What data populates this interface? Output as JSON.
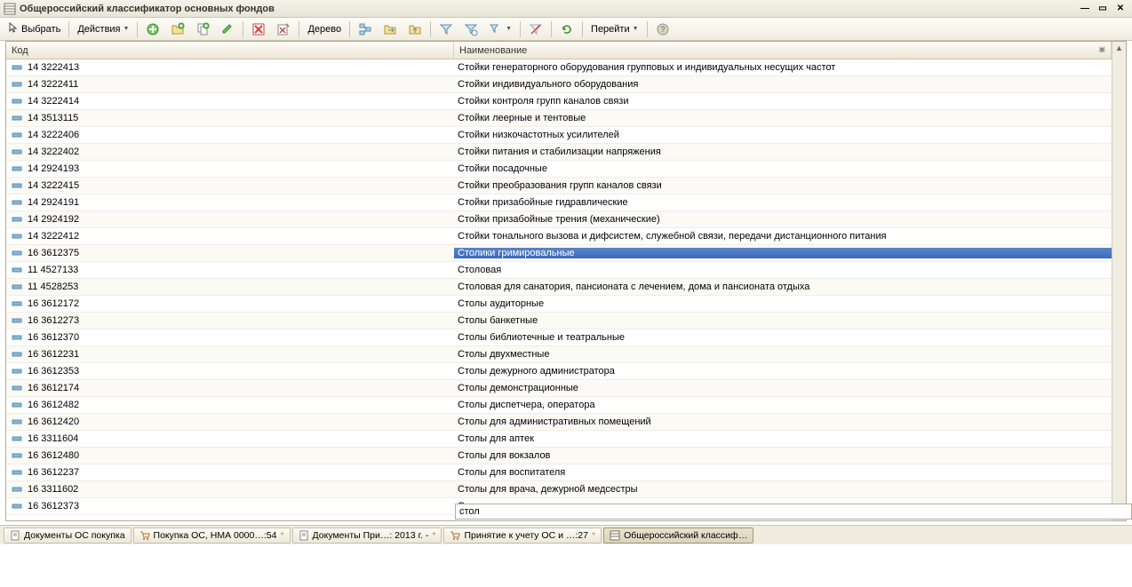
{
  "window": {
    "title": "Общероссийский классификатор основных фондов"
  },
  "toolbar": {
    "select": "Выбрать",
    "actions": "Действия",
    "tree": "Дерево",
    "goto": "Перейти"
  },
  "columns": {
    "code": "Код",
    "name": "Наименование"
  },
  "rows": [
    {
      "code": "14 3222413",
      "name": "Стойки генераторного оборудования групповых и индивидуальных несущих частот"
    },
    {
      "code": "14 3222411",
      "name": "Стойки индивидуального оборудования"
    },
    {
      "code": "14 3222414",
      "name": "Стойки контроля групп каналов связи"
    },
    {
      "code": "14 3513115",
      "name": "Стойки леерные и тентовые"
    },
    {
      "code": "14 3222406",
      "name": "Стойки низкочастотных усилителей"
    },
    {
      "code": "14 3222402",
      "name": "Стойки питания и стабилизации напряжения"
    },
    {
      "code": "14 2924193",
      "name": "Стойки посадочные"
    },
    {
      "code": "14 3222415",
      "name": "Стойки преобразования групп каналов связи"
    },
    {
      "code": "14 2924191",
      "name": "Стойки призабойные гидравлические"
    },
    {
      "code": "14 2924192",
      "name": "Стойки призабойные трения (механические)"
    },
    {
      "code": "14 3222412",
      "name": "Стойки тонального вызова и дифсистем, служебной связи, передачи дистанционного питания"
    },
    {
      "code": "16 3612375",
      "name": "Столики гримировальные",
      "selected": true
    },
    {
      "code": "11 4527133",
      "name": "Столовая"
    },
    {
      "code": "11 4528253",
      "name": "Столовая для санатория, пансионата с лечением, дома и пансионата отдыха"
    },
    {
      "code": "16 3612172",
      "name": "Столы аудиторные"
    },
    {
      "code": "16 3612273",
      "name": "Столы банкетные"
    },
    {
      "code": "16 3612370",
      "name": "Столы библиотечные и театральные"
    },
    {
      "code": "16 3612231",
      "name": "Столы двухместные"
    },
    {
      "code": "16 3612353",
      "name": "Столы дежурного администратора"
    },
    {
      "code": "16 3612174",
      "name": "Столы демонстрационные"
    },
    {
      "code": "16 3612482",
      "name": "Столы диспетчера, оператора"
    },
    {
      "code": "16 3612420",
      "name": "Столы для административных помещений"
    },
    {
      "code": "16 3311604",
      "name": "Столы для аптек"
    },
    {
      "code": "16 3612480",
      "name": "Столы для вокзалов"
    },
    {
      "code": "16 3612237",
      "name": "Столы для воспитателя"
    },
    {
      "code": "16 3311602",
      "name": "Столы для врача, дежурной медсестры"
    },
    {
      "code": "16 3612373",
      "name": "Столы для газетных подшивок"
    }
  ],
  "search": {
    "value": "стол"
  },
  "tabs": [
    {
      "label": "Документы ОС покупка",
      "icon": "doc"
    },
    {
      "label": "Покупка ОС, НМА 0000…:54",
      "icon": "cart",
      "star": true
    },
    {
      "label": "Документы При…: 2013 г. -",
      "icon": "doc",
      "star": true
    },
    {
      "label": "Принятие к учету ОС и …:27",
      "icon": "cart",
      "star": true
    },
    {
      "label": "Общероссийский классиф…",
      "icon": "grid",
      "active": true
    }
  ]
}
